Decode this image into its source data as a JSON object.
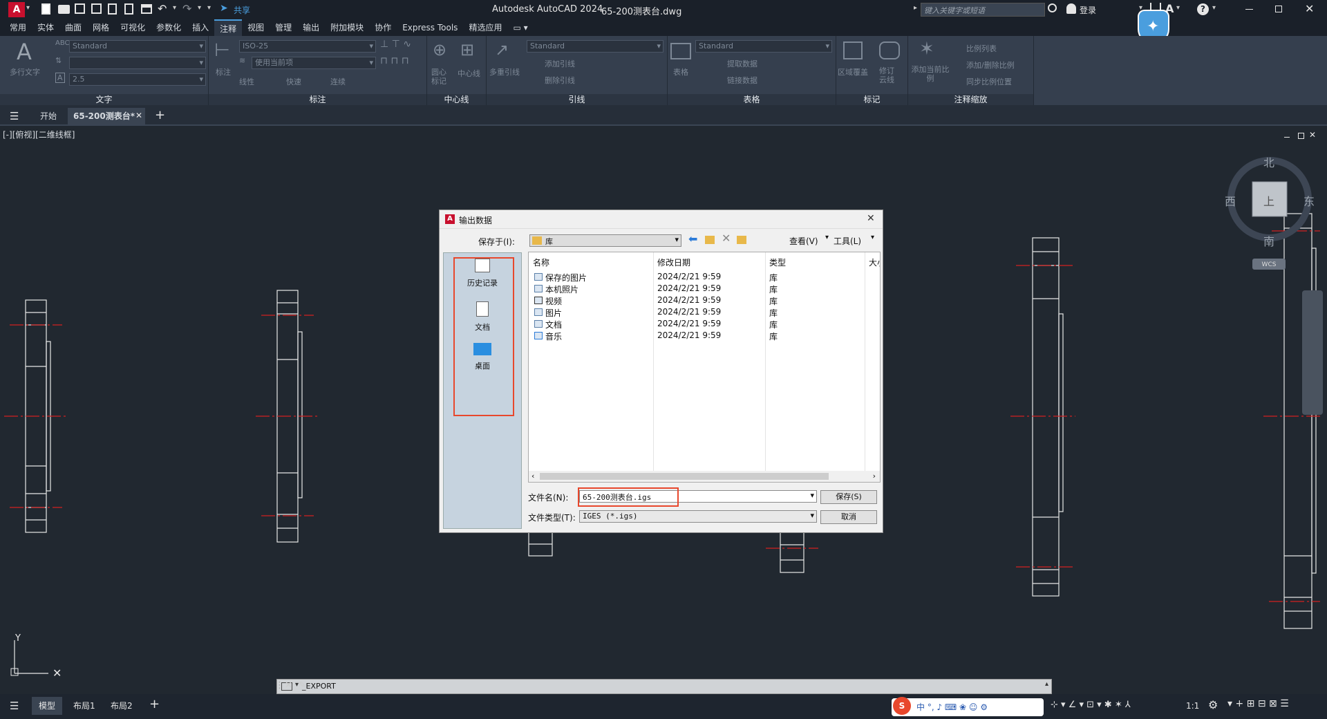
{
  "title_bar": {
    "app_title": "Autodesk AutoCAD 2024",
    "file_name": "65-200测表台.dwg",
    "share_label": "共享",
    "search_placeholder": "键入关键字或短语",
    "login_label": "登录"
  },
  "menu_tabs": [
    "常用",
    "实体",
    "曲面",
    "网格",
    "可视化",
    "参数化",
    "插入",
    "注释",
    "视图",
    "管理",
    "输出",
    "附加模块",
    "协作",
    "Express Tools",
    "精选应用"
  ],
  "active_menu_tab": "注释",
  "ribbon": {
    "text_panel": {
      "label": "文字",
      "big_button": "多行文字",
      "style_combo": "Standard",
      "height_combo": "2.5"
    },
    "dim_panel": {
      "label": "标注",
      "big_button": "标注",
      "style_combo": "ISO-25",
      "layer_combo": "使用当前项",
      "linear": "线性",
      "quick": "快速",
      "continue": "连续"
    },
    "centerline_panel": {
      "label": "中心线",
      "center_mark": "圆心标记",
      "center_line": "中心线"
    },
    "leader_panel": {
      "label": "引线",
      "multileader": "多重引线",
      "style_combo": "Standard",
      "add": "添加引线",
      "remove": "删除引线"
    },
    "table_panel": {
      "label": "表格",
      "table": "表格",
      "style_combo": "Standard",
      "extract": "提取数据",
      "link": "链接数据"
    },
    "markup_panel": {
      "label": "标记",
      "wipeout": "区域覆盖",
      "revcloud": "修订云线"
    },
    "scale_panel": {
      "label": "注释缩放",
      "add_scale": "添加当前比例",
      "scale_list": "比例列表",
      "add_remove": "添加/删除比例",
      "sync": "同步比例位置"
    }
  },
  "doc_tabs": {
    "start": "开始",
    "active": "65-200测表台*"
  },
  "viewport_label": "[-][俯视][二维线框]",
  "viewcube": {
    "north": "北",
    "south": "南",
    "east": "东",
    "west": "西",
    "top": "上",
    "wcs": "WCS"
  },
  "ucs": {
    "y": "Y"
  },
  "command_line": {
    "text": "_EXPORT"
  },
  "layout_tabs": {
    "model": "模型",
    "layout1": "布局1",
    "layout2": "布局2"
  },
  "status": {
    "scale": "1:1"
  },
  "dialog": {
    "title": "输出数据",
    "save_in_label": "保存于(I):",
    "save_in_value": "库",
    "views_label": "查看(V)",
    "tools_label": "工具(L)",
    "places": [
      {
        "label": "历史记录",
        "icon": "history-icon"
      },
      {
        "label": "文档",
        "icon": "document-icon"
      },
      {
        "label": "桌面",
        "icon": "desktop-icon"
      }
    ],
    "columns": {
      "name": "名称",
      "modified": "修改日期",
      "type": "类型",
      "size": "大小"
    },
    "files": [
      {
        "name": "保存的图片",
        "date": "2024/2/21 9:59",
        "type": "库"
      },
      {
        "name": "本机照片",
        "date": "2024/2/21 9:59",
        "type": "库"
      },
      {
        "name": "视频",
        "date": "2024/2/21 9:59",
        "type": "库"
      },
      {
        "name": "图片",
        "date": "2024/2/21 9:59",
        "type": "库"
      },
      {
        "name": "文档",
        "date": "2024/2/21 9:59",
        "type": "库"
      },
      {
        "name": "音乐",
        "date": "2024/2/21 9:59",
        "type": "库"
      }
    ],
    "filename_label": "文件名(N):",
    "filename_value": "65-200测表台.igs",
    "filetype_label": "文件类型(T):",
    "filetype_value": "IGES (*.igs)",
    "save_button": "保存(S)",
    "cancel_button": "取消"
  },
  "colors": {
    "accent": "#4a9ede",
    "highlight": "#e8472c",
    "drawing_bg": "#212830",
    "centerline": "#d42020"
  }
}
